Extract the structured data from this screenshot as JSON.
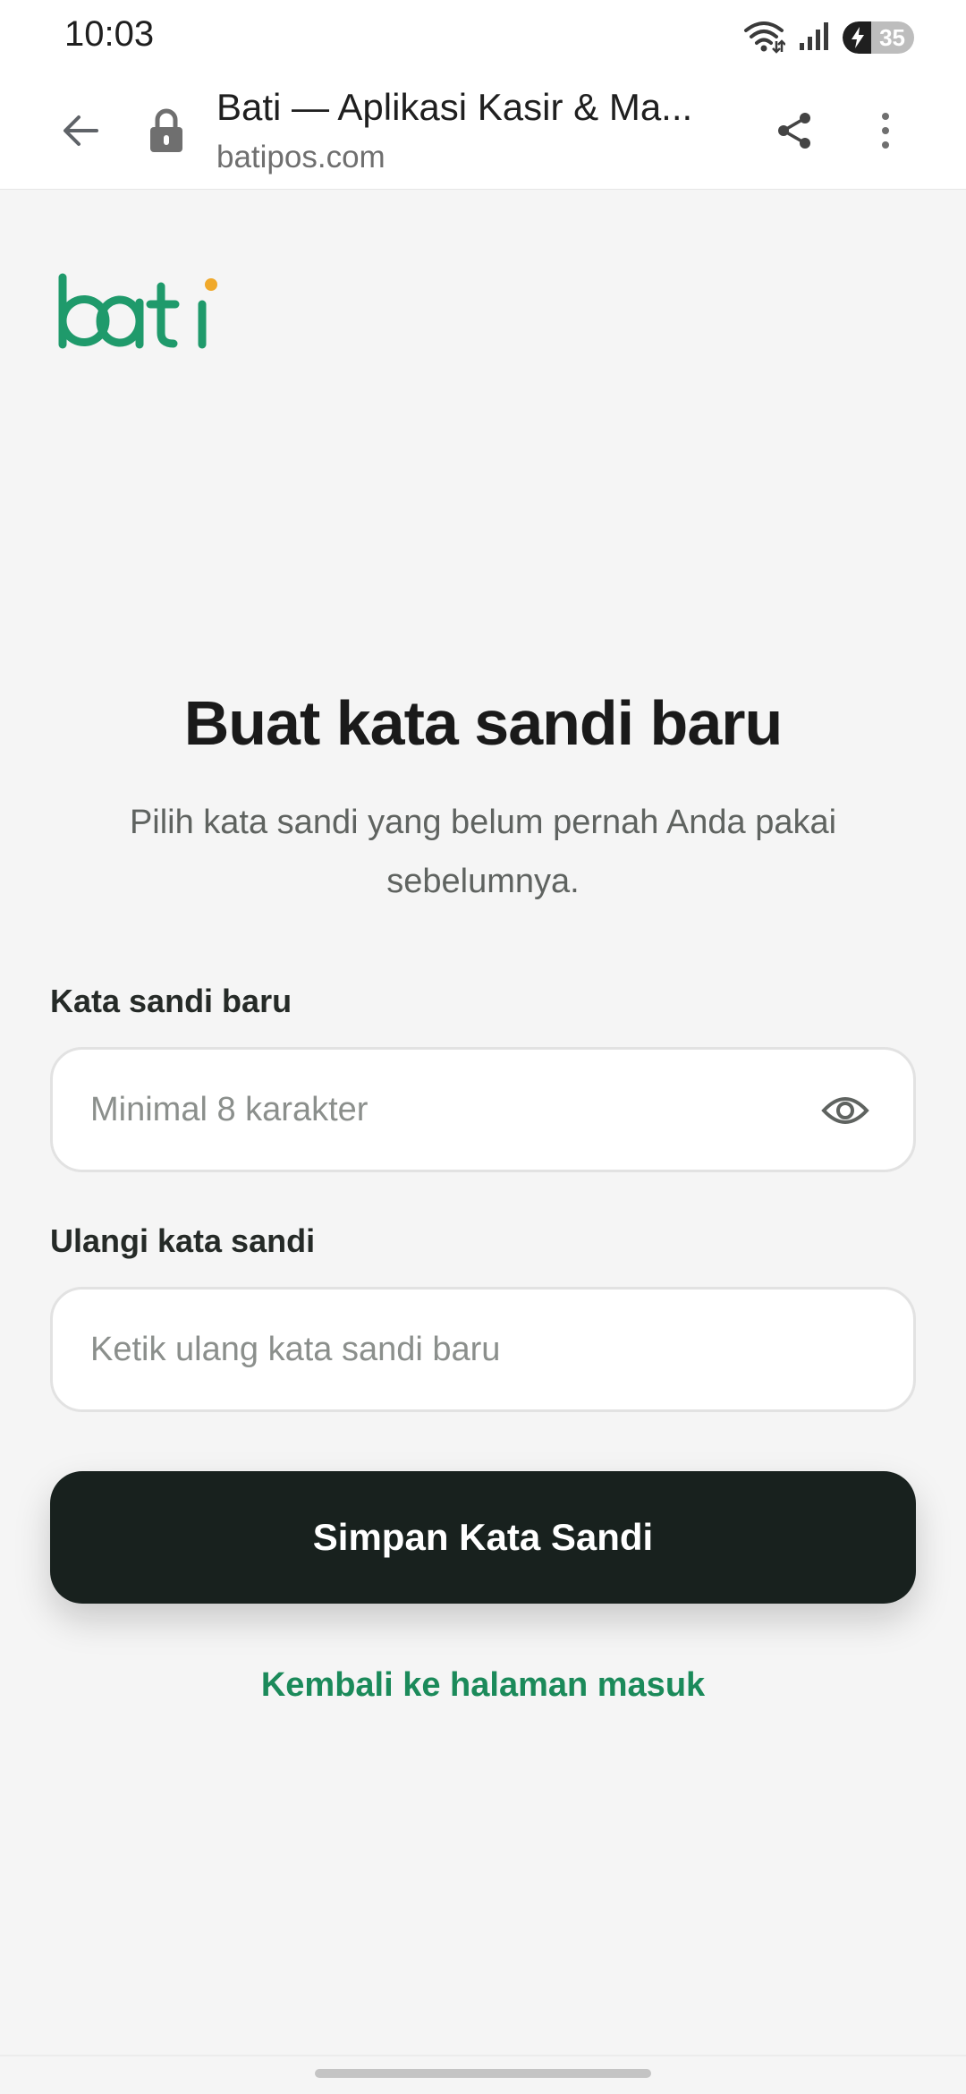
{
  "status_bar": {
    "time": "10:03",
    "battery": "35",
    "icons": [
      "wifi-icon",
      "signal-icon",
      "battery-icon"
    ]
  },
  "browser": {
    "title": "Bati — Aplikasi Kasir & Ma...",
    "url": "batipos.com",
    "icons": [
      "back-arrow-icon",
      "lock-icon",
      "share-icon",
      "more-vert-icon"
    ]
  },
  "brand": {
    "logo_text": "bati",
    "logo_color": "#1f9a6b",
    "dot_color": "#f0a92b"
  },
  "page": {
    "heading": "Buat kata sandi baru",
    "subtext": "Pilih kata sandi yang belum pernah Anda pakai sebelumnya."
  },
  "form": {
    "new_password": {
      "label": "Kata sandi baru",
      "value": "",
      "placeholder": "Minimal 8 karakter"
    },
    "confirm_password": {
      "label": "Ulangi kata sandi",
      "value": "",
      "placeholder": "Ketik ulang kata sandi baru"
    },
    "submit_label": "Simpan Kata Sandi",
    "back_link": "Kembali ke halaman masuk"
  },
  "colors": {
    "primary_button": "#18211e",
    "link": "#1b8a5a",
    "background": "#f5f5f5"
  }
}
